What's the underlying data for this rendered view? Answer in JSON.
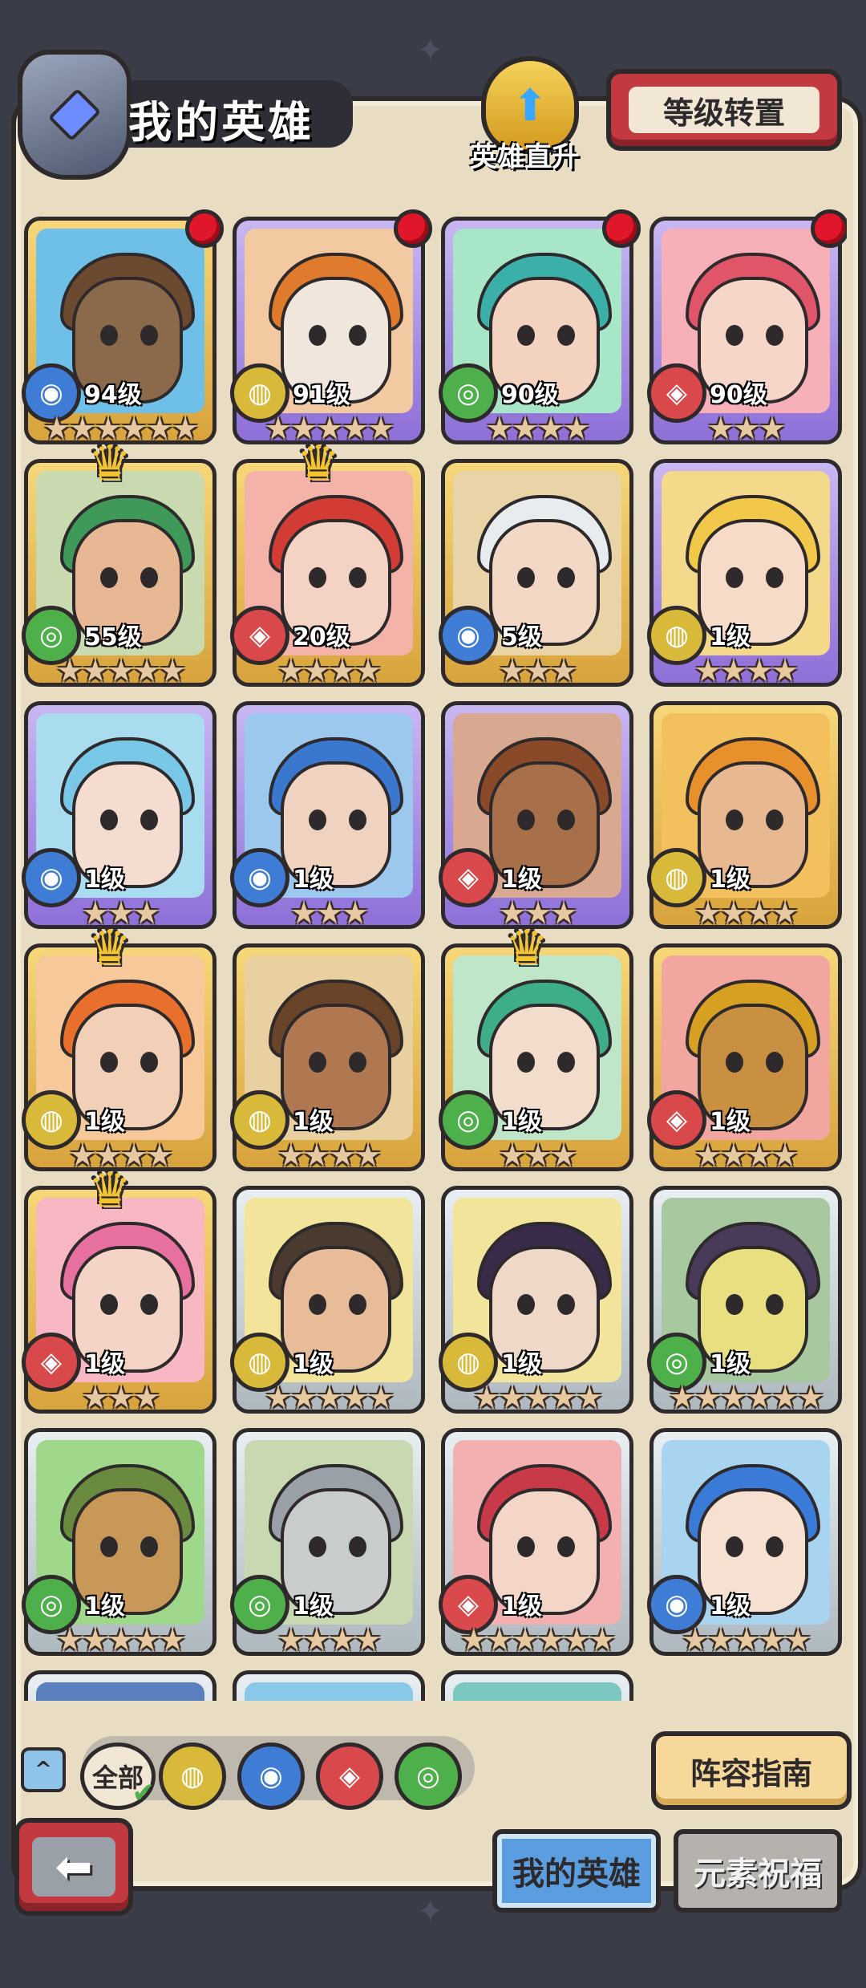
{
  "header": {
    "title": "我的英雄",
    "quick_levelup_label": "英雄直升",
    "level_transfer_label": "等级转置"
  },
  "heroes": [
    {
      "level": "94级",
      "stars": "★★★★★★",
      "frame": "gold",
      "element": "water",
      "reddot": true,
      "crown": false,
      "skin": "#8a6a4a",
      "hair": "#6b4a30",
      "bg": "#6ec0e8"
    },
    {
      "level": "91级",
      "stars": "★★★★★",
      "frame": "purple",
      "element": "earth",
      "reddot": true,
      "crown": false,
      "skin": "#f0e6dc",
      "hair": "#e07a2c",
      "bg": "#f2c9a0"
    },
    {
      "level": "90级",
      "stars": "★★★★",
      "frame": "purple",
      "element": "wind",
      "reddot": true,
      "crown": false,
      "skin": "#f3d2c0",
      "hair": "#3bb0a8",
      "bg": "#a8e6c8"
    },
    {
      "level": "90级",
      "stars": "★★★",
      "frame": "purple",
      "element": "fire",
      "reddot": true,
      "crown": false,
      "skin": "#f6d6c8",
      "hair": "#e0556a",
      "bg": "#f7b0b8"
    },
    {
      "level": "55级",
      "stars": "★★★★★",
      "frame": "gold",
      "element": "wind",
      "reddot": false,
      "crown": true,
      "skin": "#e8b894",
      "hair": "#3f9a5a",
      "bg": "#c9d9b0"
    },
    {
      "level": "20级",
      "stars": "★★★★",
      "frame": "gold",
      "element": "fire",
      "reddot": false,
      "crown": true,
      "skin": "#f4d2c4",
      "hair": "#d23c34",
      "bg": "#f3b3a8"
    },
    {
      "level": "5级",
      "stars": "★★★",
      "frame": "gold",
      "element": "water",
      "reddot": false,
      "crown": false,
      "skin": "#f4d8c6",
      "hair": "#e8ecef",
      "bg": "#e9d4a8"
    },
    {
      "level": "1级",
      "stars": "★★★★",
      "frame": "purple",
      "element": "earth",
      "reddot": false,
      "crown": false,
      "skin": "#f6dcc8",
      "hair": "#f2c84a",
      "bg": "#f5d98a"
    },
    {
      "level": "1级",
      "stars": "★★★",
      "frame": "purple",
      "element": "water",
      "reddot": false,
      "crown": false,
      "skin": "#f4dcd0",
      "hair": "#7ac8e8",
      "bg": "#a8dcee"
    },
    {
      "level": "1级",
      "stars": "★★★",
      "frame": "purple",
      "element": "water",
      "reddot": false,
      "crown": false,
      "skin": "#f0d2c0",
      "hair": "#3a78d0",
      "bg": "#9cc8ee"
    },
    {
      "level": "1级",
      "stars": "★★★",
      "frame": "purple",
      "element": "fire",
      "reddot": false,
      "crown": false,
      "skin": "#a8704a",
      "hair": "#8a4a2a",
      "bg": "#d8a890"
    },
    {
      "level": "1级",
      "stars": "★★★★",
      "frame": "gold",
      "element": "earth",
      "reddot": false,
      "crown": false,
      "skin": "#e8b890",
      "hair": "#e8902c",
      "bg": "#f2c05c"
    },
    {
      "level": "1级",
      "stars": "★★★★",
      "frame": "gold",
      "element": "earth",
      "reddot": false,
      "crown": true,
      "skin": "#f2d0b8",
      "hair": "#e8702c",
      "bg": "#f6c89a"
    },
    {
      "level": "1级",
      "stars": "★★★★",
      "frame": "gold",
      "element": "earth",
      "reddot": false,
      "crown": false,
      "skin": "#b07850",
      "hair": "#6a4428",
      "bg": "#e8d0a0"
    },
    {
      "level": "1级",
      "stars": "★★★",
      "frame": "gold",
      "element": "wind",
      "reddot": false,
      "crown": true,
      "skin": "#f2dccc",
      "hair": "#3eae88",
      "bg": "#bfe6c8"
    },
    {
      "level": "1级",
      "stars": "★★★★",
      "frame": "gold",
      "element": "fire",
      "reddot": false,
      "crown": false,
      "skin": "#c89040",
      "hair": "#d8a020",
      "bg": "#f2a6a0"
    },
    {
      "level": "1级",
      "stars": "★★★",
      "frame": "gold",
      "element": "fire",
      "reddot": false,
      "crown": true,
      "skin": "#f4d4c6",
      "hair": "#e870a0",
      "bg": "#f7b8c4"
    },
    {
      "level": "1级",
      "stars": "★★★★★",
      "frame": "silver",
      "element": "earth",
      "reddot": false,
      "crown": false,
      "skin": "#e8bc98",
      "hair": "#4a3a30",
      "bg": "#f2e49a"
    },
    {
      "level": "1级",
      "stars": "★★★★★",
      "frame": "silver",
      "element": "earth",
      "reddot": false,
      "crown": false,
      "skin": "#f0d8c8",
      "hair": "#3a2a4a",
      "bg": "#f2e49a"
    },
    {
      "level": "1级",
      "stars": "★★★★★★",
      "frame": "silver",
      "element": "wind",
      "reddot": false,
      "crown": false,
      "skin": "#e8e080",
      "hair": "#4a3a5a",
      "bg": "#a8c8a0"
    },
    {
      "level": "1级",
      "stars": "★★★★★",
      "frame": "silver",
      "element": "wind",
      "reddot": false,
      "crown": false,
      "skin": "#c89858",
      "hair": "#6a8a40",
      "bg": "#9fd88a"
    },
    {
      "level": "1级",
      "stars": "★★★★",
      "frame": "silver",
      "element": "wind",
      "reddot": false,
      "crown": false,
      "skin": "#c8cccc",
      "hair": "#9aa0a8",
      "bg": "#c8d8b0"
    },
    {
      "level": "1级",
      "stars": "★★★★★★",
      "frame": "silver",
      "element": "fire",
      "reddot": false,
      "crown": false,
      "skin": "#f4d6c8",
      "hair": "#c83a48",
      "bg": "#f2b0b0"
    },
    {
      "level": "1级",
      "stars": "★★★★★",
      "frame": "silver",
      "element": "water",
      "reddot": false,
      "crown": false,
      "skin": "#f6e0d2",
      "hair": "#3a7ad8",
      "bg": "#a8d4f0"
    },
    {
      "level": "",
      "stars": "",
      "frame": "silver",
      "element": "",
      "reddot": false,
      "crown": false,
      "skin": "#2a4a8a",
      "hair": "#1e3060",
      "bg": "#5a80c0"
    },
    {
      "level": "",
      "stars": "",
      "frame": "silver",
      "element": "",
      "reddot": false,
      "crown": false,
      "skin": "#7ac0e8",
      "hair": "#4a90c8",
      "bg": "#8ac8e8"
    },
    {
      "level": "",
      "stars": "",
      "frame": "silver",
      "element": "",
      "reddot": false,
      "crown": false,
      "skin": "#3aa0a0",
      "hair": "#2a7070",
      "bg": "#7ac8c0"
    }
  ],
  "filters": {
    "all_label": "全部",
    "elements": [
      "earth",
      "water",
      "fire",
      "wind"
    ]
  },
  "lineup_guide_label": "阵容指南",
  "tabs": {
    "my_heroes_label": "我的英雄",
    "element_blessing_label": "元素祝福"
  },
  "colors": {
    "water": "#3f7cd6",
    "wind": "#4eb04a",
    "fire": "#d9484b",
    "earth": "#d8b93a"
  }
}
